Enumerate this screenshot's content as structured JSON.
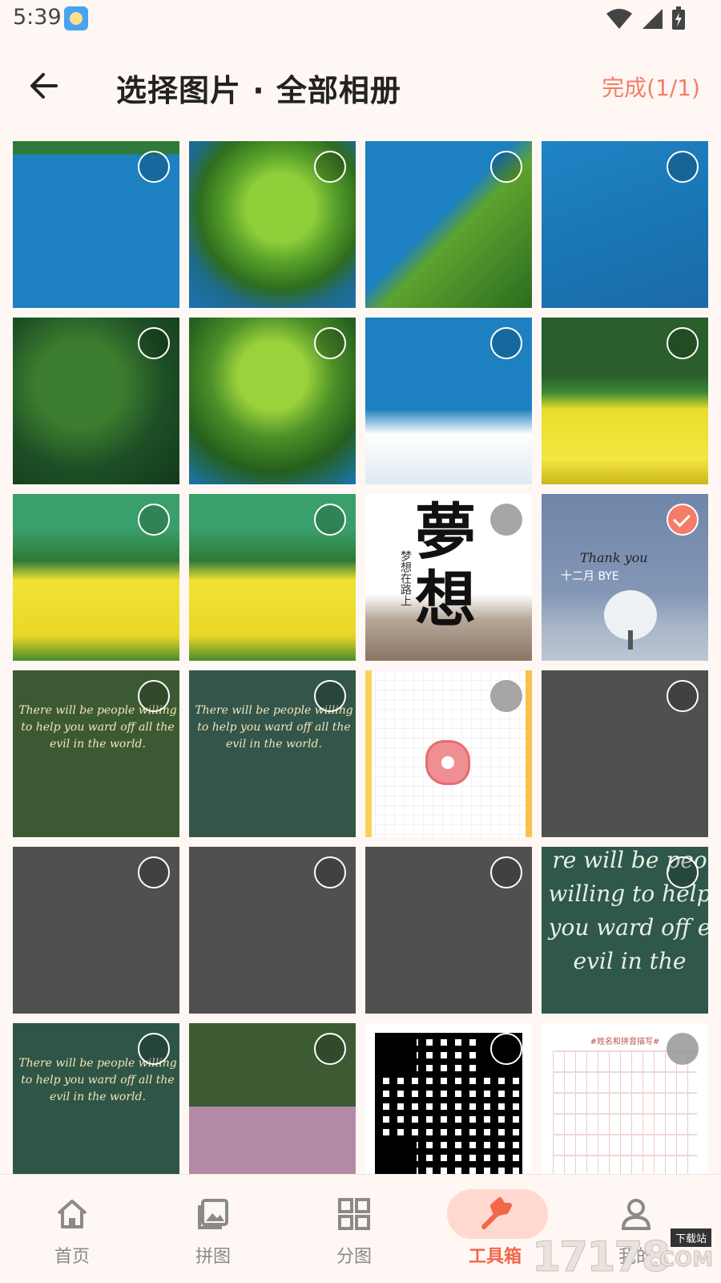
{
  "status_bar": {
    "time": "5:39"
  },
  "header": {
    "title": "选择图片 · 全部相册",
    "done_label": "完成(1/1)"
  },
  "grid": {
    "quote_text": "There will be people willing to help you ward off all the evil in the world.",
    "quote_big_text": "re will be peo willing to help you ward off e evil in the",
    "poster_title": "夢想",
    "poster_sub": "梦想在路上",
    "poster2_line1": "Thank you",
    "poster2_line2": "十二月 BYE",
    "sheet_head": "#姓名和拼音描写#",
    "selected_count": 1
  },
  "bottom_nav": {
    "items": [
      {
        "label": "首页",
        "icon": "home-icon"
      },
      {
        "label": "拼图",
        "icon": "gallery-icon"
      },
      {
        "label": "分图",
        "icon": "grid-icon"
      },
      {
        "label": "工具箱",
        "icon": "wrench-icon",
        "active": true
      },
      {
        "label": "我的",
        "icon": "person-icon"
      }
    ]
  },
  "watermark": {
    "number": "17178",
    "tag": "下载站",
    "domain": ".COM"
  },
  "colors": {
    "accent": "#f57d68",
    "active_nav": "#f2664a",
    "background": "#fff7f3"
  }
}
